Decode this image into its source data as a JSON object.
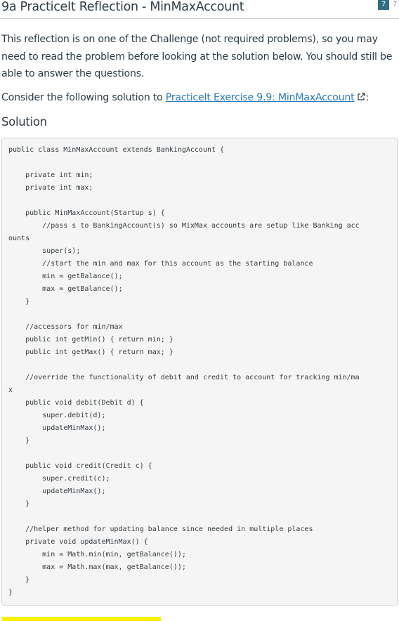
{
  "header": {
    "title": "9a PracticeIt Reflection - MinMaxAccount",
    "badge_primary": "7",
    "badge_secondary": "7"
  },
  "content": {
    "intro": "This reflection is on one of the Challenge (not required problems), so you may need to read the problem before looking at the solution below. You should still be able to answer the questions.",
    "consider_prefix": "Consider the following solution to ",
    "consider_link": "PracticeIt Exercise 9.9: MinMaxAccount",
    "consider_suffix": ":",
    "link_icon": "external-link-icon",
    "solution_heading": "Solution"
  },
  "code": {
    "lines": [
      "public class MinMaxAccount extends BankingAccount {",
      "",
      "    private int min;",
      "    private int max;",
      "",
      "    public MinMaxAccount(Startup s) {",
      "        //pass s to BankingAccount(s) so MixMax accounts are setup like Banking acc",
      "ounts",
      "        super(s);",
      "        //start the min and max for this account as the starting balance",
      "        min = getBalance();",
      "        max = getBalance();",
      "    }",
      "",
      "    //accessors for min/max",
      "    public int getMin() { return min; }",
      "    public int getMax() { return max; }",
      "",
      "    //override the functionality of debit and credit to account for tracking min/ma",
      "x",
      "    public void debit(Debit d) {",
      "        super.debit(d);",
      "        updateMinMax();",
      "    }",
      "",
      "    public void credit(Credit c) {",
      "        super.credit(c);",
      "        updateMinMax();",
      "    }",
      "",
      "    //helper method for updating balance since needed in multiple places",
      "    private void updateMinMax() {",
      "        min = Math.min(min, getBalance());",
      "        max = Math.max(max, getBalance());",
      "    }",
      "}"
    ]
  },
  "colors": {
    "text": "#2d3b45",
    "link": "#2b7abc",
    "badge": "#2e6f86",
    "code_background": "#f5f5f5",
    "highlight": "#ffef00"
  }
}
